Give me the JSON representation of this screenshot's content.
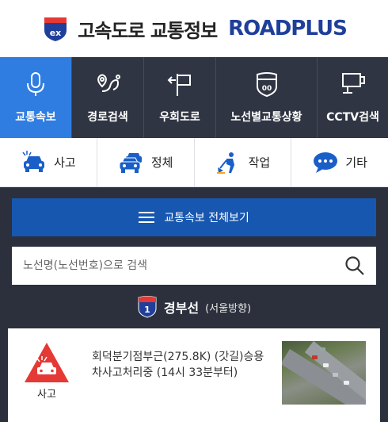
{
  "header": {
    "title_ko": "고속도로 교통정보",
    "title_en": "ROADPLUS",
    "logo_text": "ex"
  },
  "nav": [
    {
      "label": "교통속보",
      "icon": "microphone-icon",
      "active": true
    },
    {
      "label": "경로검색",
      "icon": "route-pin-icon",
      "active": false
    },
    {
      "label": "우회도로",
      "icon": "detour-sign-icon",
      "active": false
    },
    {
      "label": "노선별교통상황",
      "icon": "highway-shield-icon",
      "active": false
    },
    {
      "label": "CCTV검색",
      "icon": "cctv-camera-icon",
      "active": false
    }
  ],
  "categories": [
    {
      "label": "사고",
      "icon": "accident-car-icon"
    },
    {
      "label": "정체",
      "icon": "congestion-cars-icon"
    },
    {
      "label": "작업",
      "icon": "road-work-icon"
    },
    {
      "label": "기타",
      "icon": "speech-bubble-icon"
    }
  ],
  "all_button": {
    "label": "교통속보 전체보기"
  },
  "search": {
    "placeholder": "노선명(노선번호)으로 검색"
  },
  "route": {
    "number": "1",
    "name": "경부선",
    "direction": "(서울방향)"
  },
  "incident": {
    "type_label": "사고",
    "description": "회덕분기점부근(275.8K) (갓길)승용차사고처리중 (14시 33분부터)"
  },
  "colors": {
    "accent": "#2f7de1",
    "nav_bg": "#2f3542",
    "panel_bg": "#2b303c",
    "button_bg": "#1757b0",
    "brand": "#1f3f9b",
    "alert_red": "#e53935"
  }
}
